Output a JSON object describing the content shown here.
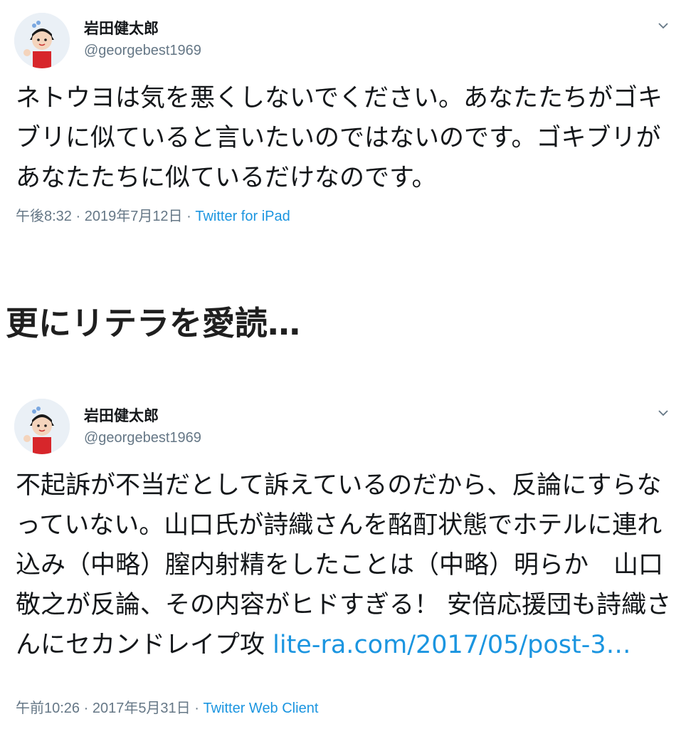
{
  "tweets": [
    {
      "name": "岩田健太郎",
      "handle": "@georgebest1969",
      "text": "ネトウヨは気を悪くしないでください。あなたたちがゴキブリに似ていると言いたいのではないのです。ゴキブリがあなたたちに似ているだけなのです。",
      "link": "",
      "timestamp": "午後8:32 · 2019年7月12日 · ",
      "source": "Twitter for iPad"
    },
    {
      "name": "岩田健太郎",
      "handle": "@georgebest1969",
      "text": "不起訴が不当だとして訴えているのだから、反論にすらなっていない。山口氏が詩織さんを酩酊状態でホテルに連れ込み（中略）膣内射精をしたことは（中略）明らか　山口敬之が反論、その内容がヒドすぎる！ 安倍応援団も詩織さんにセカンドレイプ攻 ",
      "link": "lite-ra.com/2017/05/post-3…",
      "timestamp": "午前10:26 · 2017年5月31日 · ",
      "source": "Twitter Web Client"
    }
  ],
  "heading": "更にリテラを愛読…",
  "colors": {
    "text": "#14171a",
    "secondary": "#657786",
    "link": "#1b95e0"
  },
  "icons": {
    "avatar": "cartoon-girl-avatar",
    "menu": "chevron-down-icon"
  }
}
